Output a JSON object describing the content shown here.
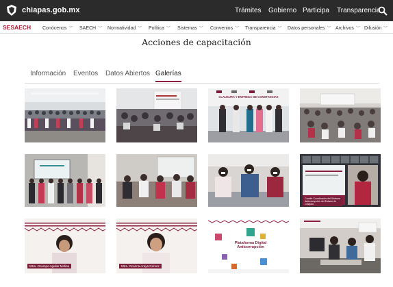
{
  "gov_bar": {
    "domain": "chiapas.gob.mx",
    "links": [
      "Trámites",
      "Gobierno",
      "Participa",
      "Transparencia"
    ],
    "search_icon": "search-icon",
    "logo_icon": "shield-icon"
  },
  "sec_nav": {
    "brand": "SESAECH",
    "items": [
      "Conócenos",
      "SAECH",
      "Normatividad",
      "Política",
      "Sistemas",
      "Convenios",
      "Transparencia",
      "Datos personales",
      "Archivos",
      "Difusión"
    ]
  },
  "page": {
    "title": "Acciones de capacitación"
  },
  "tabs": {
    "items": [
      "Información",
      "Eventos",
      "Datos Abiertos",
      "Galerías"
    ],
    "active": "Galerías"
  },
  "gallery": {
    "photos": [
      {
        "overlay": ""
      },
      {
        "overlay": ""
      },
      {
        "overlay": "CLAUSURA Y ENTREGA DE CONSTANCIAS"
      },
      {
        "overlay": ""
      },
      {
        "overlay": ""
      },
      {
        "overlay": ""
      },
      {
        "overlay": ""
      },
      {
        "overlay": "Comité Coordinador del Sistema Anticorrupción del Estado de Chiapas"
      },
      {
        "overlay": "Mtra. Ocampo Aguilar Molina"
      },
      {
        "overlay": "Mtra. Ocarina Araya Gómez"
      },
      {
        "overlay": "Plataforma Digital Anticorrupción"
      },
      {
        "overlay": ""
      }
    ]
  },
  "colors": {
    "gov_bar": "#2b2b2b",
    "brand": "#a41a35",
    "tab_active": "#8b1e3f"
  }
}
